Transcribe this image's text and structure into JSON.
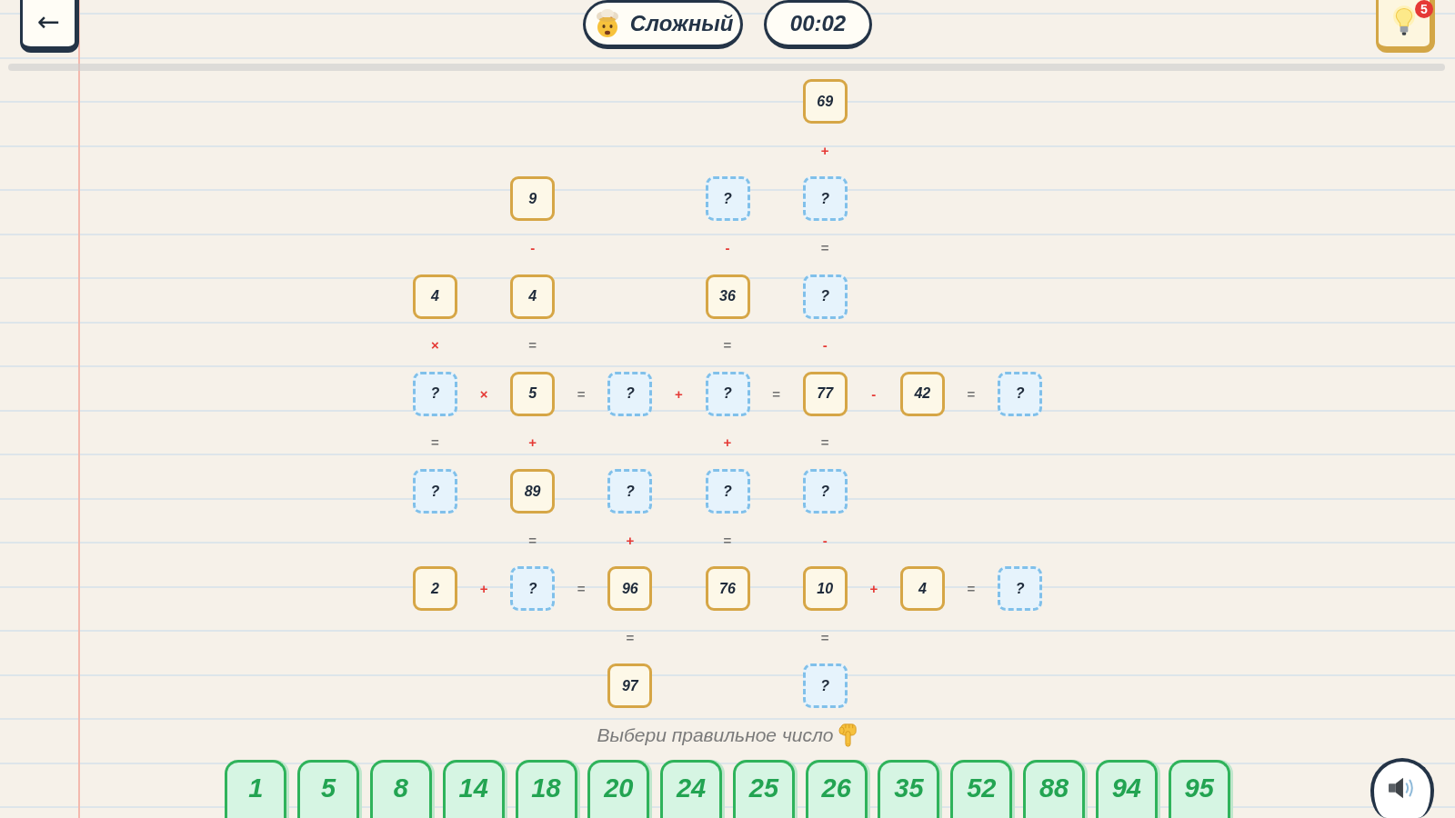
{
  "back_button": {
    "label": "←"
  },
  "difficulty": {
    "label": "Сложный"
  },
  "timer": "00:02",
  "hint_button": {
    "badge": "5"
  },
  "board": {
    "rows": [
      [
        {
          "kind": "gap"
        },
        {
          "kind": "gap"
        },
        {
          "kind": "gap"
        },
        {
          "kind": "gap"
        },
        {
          "kind": "gap"
        },
        {
          "kind": "gap"
        },
        {
          "kind": "gap"
        },
        {
          "kind": "gap"
        },
        {
          "kind": "given",
          "value": "69"
        },
        {
          "kind": "gap"
        },
        {
          "kind": "gap"
        },
        {
          "kind": "gap"
        },
        {
          "kind": "gap"
        }
      ],
      [
        {
          "kind": "gap"
        },
        {
          "kind": "gap"
        },
        {
          "kind": "gap"
        },
        {
          "kind": "gap"
        },
        {
          "kind": "gap"
        },
        {
          "kind": "gap"
        },
        {
          "kind": "gap"
        },
        {
          "kind": "gap"
        },
        {
          "kind": "sign",
          "value": "+"
        },
        {
          "kind": "gap"
        },
        {
          "kind": "gap"
        },
        {
          "kind": "gap"
        },
        {
          "kind": "gap"
        }
      ],
      [
        {
          "kind": "gap"
        },
        {
          "kind": "gap"
        },
        {
          "kind": "given",
          "value": "9"
        },
        {
          "kind": "gap"
        },
        {
          "kind": "gap"
        },
        {
          "kind": "gap"
        },
        {
          "kind": "blank",
          "value": "?"
        },
        {
          "kind": "gap"
        },
        {
          "kind": "blank",
          "value": "?"
        },
        {
          "kind": "gap"
        },
        {
          "kind": "gap"
        },
        {
          "kind": "gap"
        },
        {
          "kind": "gap"
        }
      ],
      [
        {
          "kind": "gap"
        },
        {
          "kind": "gap"
        },
        {
          "kind": "sign",
          "value": "-"
        },
        {
          "kind": "gap"
        },
        {
          "kind": "gap"
        },
        {
          "kind": "gap"
        },
        {
          "kind": "sign",
          "value": "-"
        },
        {
          "kind": "gap"
        },
        {
          "kind": "equals",
          "value": "="
        },
        {
          "kind": "gap"
        },
        {
          "kind": "gap"
        },
        {
          "kind": "gap"
        },
        {
          "kind": "gap"
        }
      ],
      [
        {
          "kind": "given",
          "value": "4"
        },
        {
          "kind": "gap"
        },
        {
          "kind": "given",
          "value": "4"
        },
        {
          "kind": "gap"
        },
        {
          "kind": "gap"
        },
        {
          "kind": "gap"
        },
        {
          "kind": "given",
          "value": "36"
        },
        {
          "kind": "gap"
        },
        {
          "kind": "blank",
          "value": "?"
        },
        {
          "kind": "gap"
        },
        {
          "kind": "gap"
        },
        {
          "kind": "gap"
        },
        {
          "kind": "gap"
        }
      ],
      [
        {
          "kind": "sign",
          "value": "×"
        },
        {
          "kind": "gap"
        },
        {
          "kind": "equals",
          "value": "="
        },
        {
          "kind": "gap"
        },
        {
          "kind": "gap"
        },
        {
          "kind": "gap"
        },
        {
          "kind": "equals",
          "value": "="
        },
        {
          "kind": "gap"
        },
        {
          "kind": "sign",
          "value": "-"
        },
        {
          "kind": "gap"
        },
        {
          "kind": "gap"
        },
        {
          "kind": "gap"
        },
        {
          "kind": "gap"
        }
      ],
      [
        {
          "kind": "blank",
          "value": "?"
        },
        {
          "kind": "sign",
          "value": "×"
        },
        {
          "kind": "given",
          "value": "5"
        },
        {
          "kind": "equals",
          "value": "="
        },
        {
          "kind": "blank",
          "value": "?"
        },
        {
          "kind": "sign",
          "value": "+"
        },
        {
          "kind": "blank",
          "value": "?"
        },
        {
          "kind": "equals",
          "value": "="
        },
        {
          "kind": "given",
          "value": "77"
        },
        {
          "kind": "sign",
          "value": "-"
        },
        {
          "kind": "given",
          "value": "42"
        },
        {
          "kind": "equals",
          "value": "="
        },
        {
          "kind": "blank",
          "value": "?"
        }
      ],
      [
        {
          "kind": "equals",
          "value": "="
        },
        {
          "kind": "gap"
        },
        {
          "kind": "sign",
          "value": "+"
        },
        {
          "kind": "gap"
        },
        {
          "kind": "gap"
        },
        {
          "kind": "gap"
        },
        {
          "kind": "sign",
          "value": "+"
        },
        {
          "kind": "gap"
        },
        {
          "kind": "equals",
          "value": "="
        },
        {
          "kind": "gap"
        },
        {
          "kind": "gap"
        },
        {
          "kind": "gap"
        },
        {
          "kind": "gap"
        }
      ],
      [
        {
          "kind": "blank",
          "value": "?"
        },
        {
          "kind": "gap"
        },
        {
          "kind": "given",
          "value": "89"
        },
        {
          "kind": "gap"
        },
        {
          "kind": "blank",
          "value": "?"
        },
        {
          "kind": "gap"
        },
        {
          "kind": "blank",
          "value": "?"
        },
        {
          "kind": "gap"
        },
        {
          "kind": "blank",
          "value": "?"
        },
        {
          "kind": "gap"
        },
        {
          "kind": "gap"
        },
        {
          "kind": "gap"
        },
        {
          "kind": "gap"
        }
      ],
      [
        {
          "kind": "gap"
        },
        {
          "kind": "gap"
        },
        {
          "kind": "equals",
          "value": "="
        },
        {
          "kind": "gap"
        },
        {
          "kind": "sign",
          "value": "+"
        },
        {
          "kind": "gap"
        },
        {
          "kind": "equals",
          "value": "="
        },
        {
          "kind": "gap"
        },
        {
          "kind": "sign",
          "value": "-"
        },
        {
          "kind": "gap"
        },
        {
          "kind": "gap"
        },
        {
          "kind": "gap"
        },
        {
          "kind": "gap"
        }
      ],
      [
        {
          "kind": "given",
          "value": "2"
        },
        {
          "kind": "sign",
          "value": "+"
        },
        {
          "kind": "blank",
          "value": "?"
        },
        {
          "kind": "equals",
          "value": "="
        },
        {
          "kind": "given",
          "value": "96"
        },
        {
          "kind": "gap"
        },
        {
          "kind": "given",
          "value": "76"
        },
        {
          "kind": "gap"
        },
        {
          "kind": "given",
          "value": "10"
        },
        {
          "kind": "sign",
          "value": "+"
        },
        {
          "kind": "given",
          "value": "4"
        },
        {
          "kind": "equals",
          "value": "="
        },
        {
          "kind": "blank",
          "value": "?"
        }
      ],
      [
        {
          "kind": "gap"
        },
        {
          "kind": "gap"
        },
        {
          "kind": "gap"
        },
        {
          "kind": "gap"
        },
        {
          "kind": "equals",
          "value": "="
        },
        {
          "kind": "gap"
        },
        {
          "kind": "gap"
        },
        {
          "kind": "gap"
        },
        {
          "kind": "equals",
          "value": "="
        },
        {
          "kind": "gap"
        },
        {
          "kind": "gap"
        },
        {
          "kind": "gap"
        },
        {
          "kind": "gap"
        }
      ],
      [
        {
          "kind": "gap"
        },
        {
          "kind": "gap"
        },
        {
          "kind": "gap"
        },
        {
          "kind": "gap"
        },
        {
          "kind": "given",
          "value": "97"
        },
        {
          "kind": "gap"
        },
        {
          "kind": "gap"
        },
        {
          "kind": "gap"
        },
        {
          "kind": "blank",
          "value": "?"
        },
        {
          "kind": "gap"
        },
        {
          "kind": "gap"
        },
        {
          "kind": "gap"
        },
        {
          "kind": "gap"
        }
      ]
    ]
  },
  "prompt": "Выбери правильное число",
  "choices": [
    "1",
    "5",
    "8",
    "14",
    "18",
    "20",
    "24",
    "25",
    "26",
    "35",
    "52",
    "88",
    "94",
    "95"
  ]
}
